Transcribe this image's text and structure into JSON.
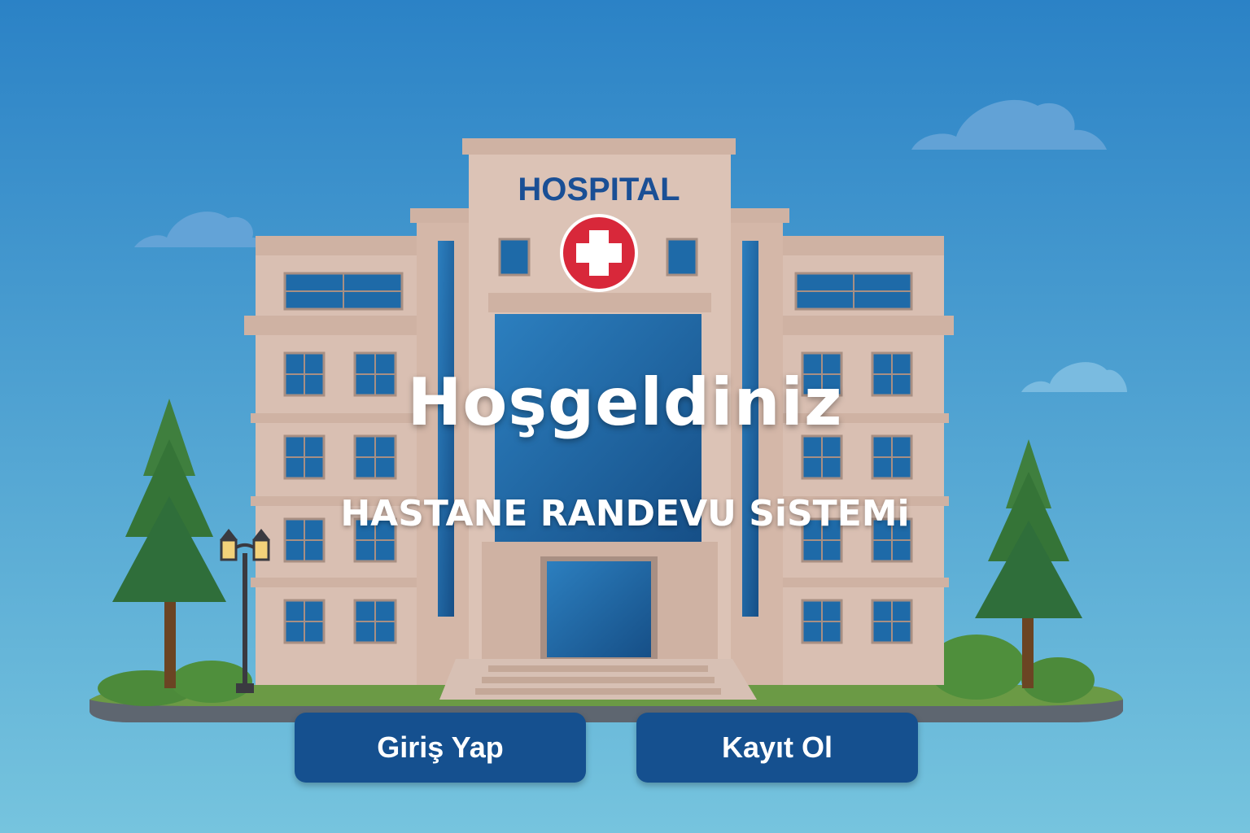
{
  "building": {
    "sign_text": "HOSPITAL"
  },
  "hero": {
    "title": "Hoşgeldiniz",
    "subtitle": "HASTANE RANDEVU SiSTEMi"
  },
  "actions": {
    "login_label": "Giriş Yap",
    "register_label": "Kayıt Ol"
  },
  "colors": {
    "sky_top": "#2b82c6",
    "sky_bottom": "#76c4de",
    "building": "#d9bfb2",
    "glass": "#1e6aa8",
    "sign": "#1a4f95",
    "cross_bg": "#d8283a",
    "button": "#15508f",
    "tree": "#2f6e3a",
    "grass": "#6b9a45"
  }
}
